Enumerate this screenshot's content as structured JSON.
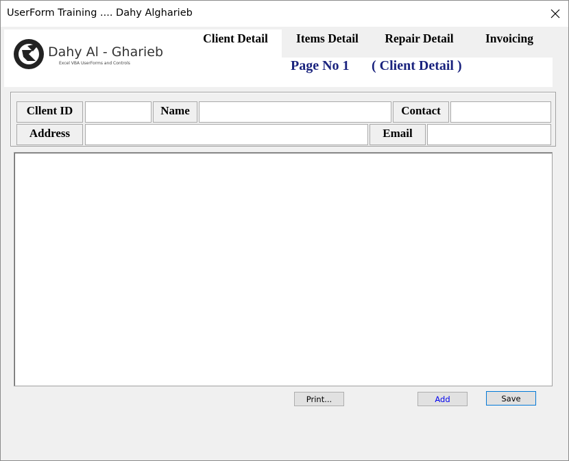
{
  "window": {
    "title": "UserForm Training .... Dahy Algharieb"
  },
  "logo": {
    "name": "Dahy Al - Gharieb",
    "tagline": "Excel VBA UserForms and Controls"
  },
  "tabs": [
    {
      "label": "Client Detail",
      "active": true
    },
    {
      "label": "Items Detail",
      "active": false
    },
    {
      "label": "Repair Detail",
      "active": false
    },
    {
      "label": "Invoicing",
      "active": false
    }
  ],
  "heading": {
    "page": "Page No 1",
    "section": "( Client Detail )"
  },
  "fields": {
    "client_id_label": "Cllent ID",
    "client_id_value": "",
    "name_label": "Name",
    "name_value": "",
    "contact_label": "Contact",
    "contact_value": "",
    "address_label": "Address",
    "address_value": "",
    "email_label": "Email",
    "email_value": ""
  },
  "buttons": {
    "print": "Print...",
    "add": "Add",
    "save": "Save"
  },
  "colors": {
    "heading": "#1a237e",
    "add_text": "#0000ee",
    "default_border": "#0078d7"
  }
}
